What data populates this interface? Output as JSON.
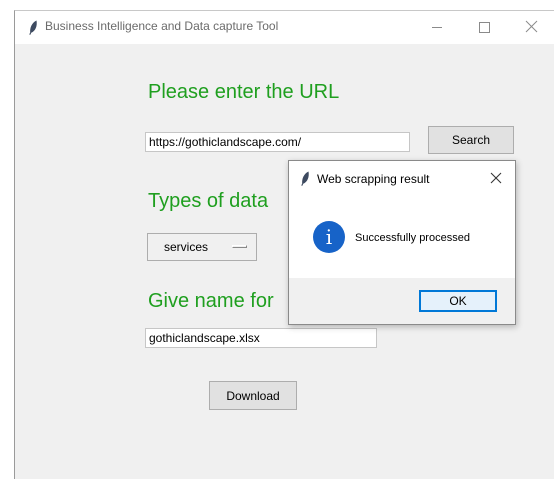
{
  "window": {
    "title": "Business Intelligence and Data capture Tool"
  },
  "form": {
    "url_label": "Please enter the URL",
    "url_value": "https://gothiclandscape.com/",
    "search_label": "Search",
    "types_label": "Types of data",
    "types_selected": "services",
    "name_label": "Give name for",
    "name_value": "gothiclandscape.xlsx",
    "download_label": "Download"
  },
  "dialog": {
    "title": "Web scrapping result",
    "message": "Successfully processed",
    "ok_label": "OK",
    "icon": "info-icon"
  },
  "colors": {
    "label_green": "#1f9f1f",
    "info_blue": "#1763c8",
    "ok_border": "#0078d7"
  }
}
